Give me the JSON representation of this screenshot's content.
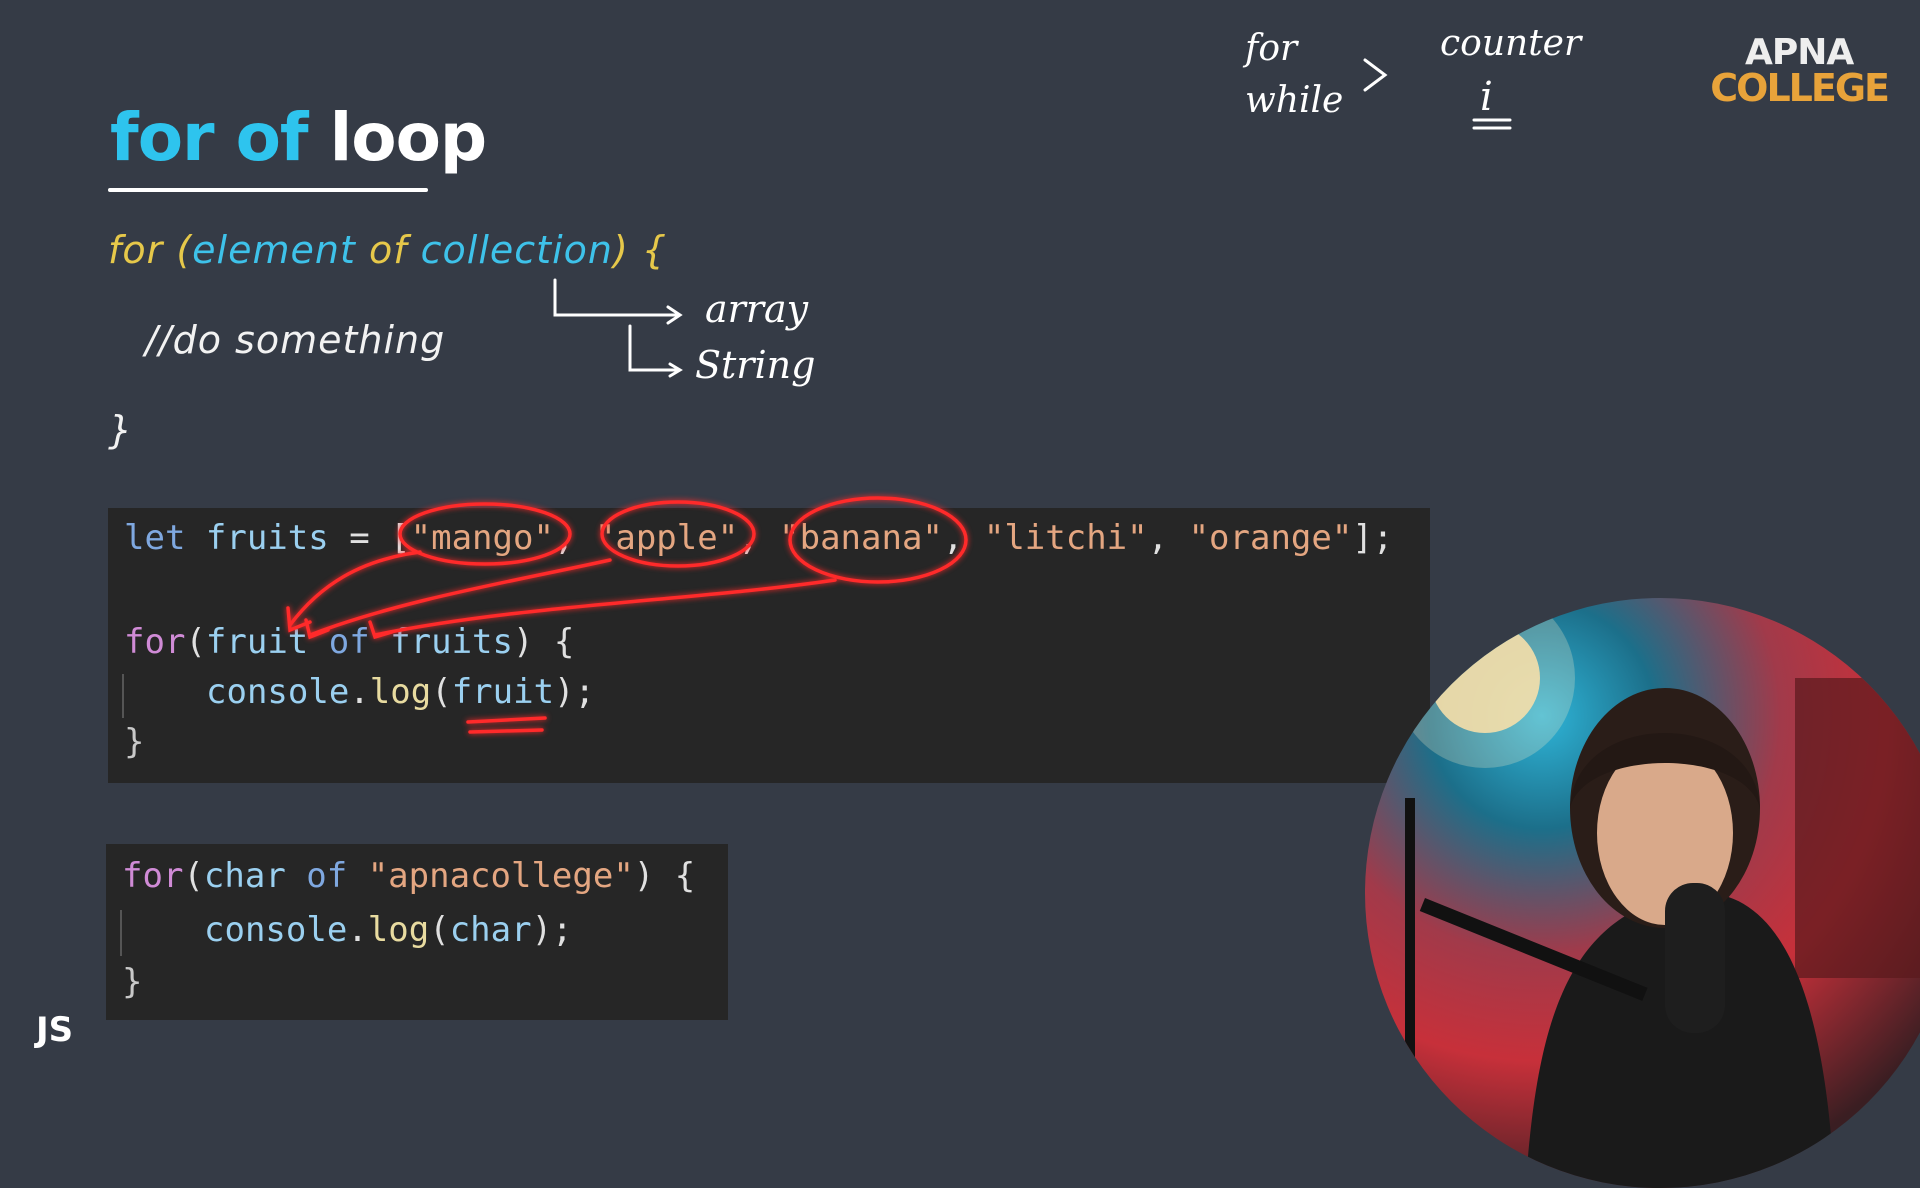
{
  "slide": {
    "title_part1": "for of",
    "title_part2": "loop",
    "syntax": {
      "line1_for": "for",
      "line1_open": " (",
      "line1_element": "element",
      "line1_of": " of ",
      "line1_collection": "collection",
      "line1_close": ") {",
      "line2": "//do something",
      "line3": "}"
    },
    "logo_line1": "APNA",
    "logo_line2": "COLLEGE",
    "badge": "JS"
  },
  "code1": {
    "l1_let": "let",
    "l1_fruits": " fruits",
    "l1_eq": " = ",
    "l1_open": "[",
    "l1_s1": "\"mango\"",
    "l1_c1": ", ",
    "l1_s2": "\"apple\"",
    "l1_c2": ", ",
    "l1_s3": "\"banana\"",
    "l1_c3": ", ",
    "l1_s4": "\"litchi\"",
    "l1_c4": ", ",
    "l1_s5": "\"orange\"",
    "l1_close": "];",
    "l2_for": "for",
    "l2_paren": "(",
    "l2_fruit": "fruit",
    "l2_of": " of ",
    "l2_fruits": "fruits",
    "l2_close": ") {",
    "l3_console": "console",
    "l3_dot": ".",
    "l3_log": "log",
    "l3_open": "(",
    "l3_arg": "fruit",
    "l3_close": ");",
    "l4": "}"
  },
  "code2": {
    "l1_for": "for",
    "l1_paren": "(",
    "l1_char": "char",
    "l1_of": " of ",
    "l1_str": "\"apnacollege\"",
    "l1_close": ") {",
    "l2_console": "console",
    "l2_dot": ".",
    "l2_log": "log",
    "l2_open": "(",
    "l2_arg": "char",
    "l2_close": ");",
    "l3": "}"
  },
  "annotations": {
    "top_left1": "for",
    "top_left2": "while",
    "top_arrow": ">",
    "top_right1": "counter",
    "top_right2": "i",
    "branch1": "array",
    "branch2": "String"
  },
  "colors": {
    "background": "#353b46",
    "title_highlight": "#2ec4ee",
    "code_bg": "#262626",
    "annotation_red": "#ff2a2a",
    "logo_orange": "#e8a33a"
  }
}
